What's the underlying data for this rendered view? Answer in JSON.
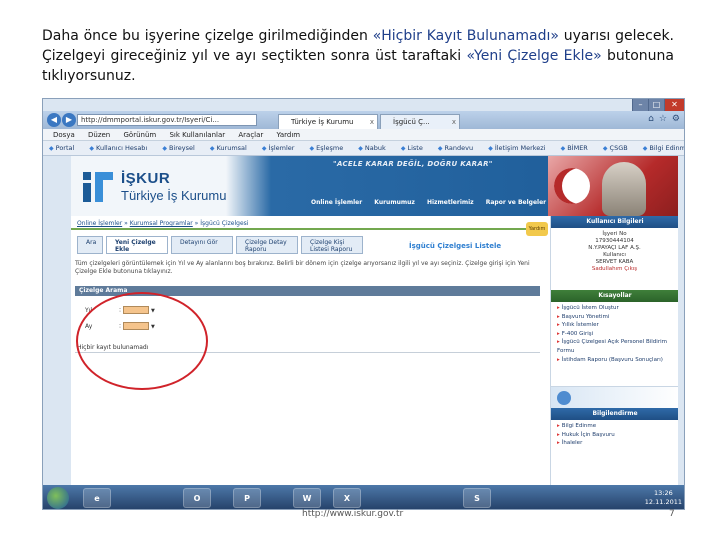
{
  "instruction": {
    "part1": "Daha önce bu işyerine çizelge girilmediğinden ",
    "highlight1": "«Hiçbir Kayıt Bulunamadı»",
    "part2": " uyarısı gelecek. Çizelgeyi gireceğiniz yıl ve ayı seçtikten sonra üst taraftaki ",
    "highlight2": "«Yeni Çizelge Ekle»",
    "part3": " butonuna tıklıyorsunuz."
  },
  "browser": {
    "address": "http://dmmportal.iskur.gov.tr/Isyeri/Ci...",
    "tabs": [
      "Türkiye İş Kurumu",
      "İşgücü Ç..."
    ],
    "menu": [
      "Dosya",
      "Düzen",
      "Görünüm",
      "Sık Kullanılanlar",
      "Araçlar",
      "Yardım"
    ],
    "favorites": [
      "Portal",
      "Kullanıcı Hesabı",
      "Bireysel",
      "Kurumsal",
      "İşlemler",
      "Eşleşme",
      "Nabuk",
      "Liste",
      "Randevu",
      "İletişim Merkezi",
      "BİMER",
      "ÇSGB",
      "Bilgi Edinme"
    ]
  },
  "site": {
    "logo_title": "İŞKUR",
    "logo_subtitle": "Türkiye İş Kurumu",
    "motto": "\"ACELE KARAR DEĞİL, DOĞRU KARAR\"",
    "nav": [
      "Online İşlemler",
      "Kurumumuz",
      "Hizmetlerimiz",
      "Rapor ve Belgeler"
    ],
    "breadcrumb": [
      "Online İşlemler",
      "Kurumsal Programlar",
      "İşgücü Çizelgesi"
    ],
    "help_badge": "Yardım"
  },
  "page": {
    "tabs": [
      "Yeni Çizelge Ekle",
      "Detayını Gör",
      "Çizelge Detay Raporu",
      "Çizelge Kişi Listesi Raporu"
    ],
    "search_tab": "Ara",
    "heading": "İşgücü Çizelgesi Listele",
    "info_text": "Tüm çizelgeleri görüntülemek için Yıl ve Ay alanlarını boş bırakınız. Belirli bir dönem için çizelge arıyorsanız ilgili yıl ve ayı seçiniz. Çizelge girişi için Yeni Çizelge Ekle butonuna tıklayınız.",
    "search_section": "Çizelge Arama",
    "year_label": "Yıl",
    "month_label": "Ay",
    "not_found": "Hiçbir kayıt bulunamadı"
  },
  "sidebar": {
    "user_head": "Kullanıcı Bilgileri",
    "user_lines": [
      "İşyeri No",
      "17930444104",
      "N.Y.PAYAÇI LAF A.Ş.",
      "Kullanıcı",
      "SERVET KABA",
      "Sadullahım Çıkış"
    ],
    "shortcuts_head": "Kısayollar",
    "shortcuts": [
      "İşgücü İstem Oluştur",
      "Başvuru Yönetimi",
      "Yıllık İstemler",
      "F-400 Girişi",
      "İşgücü Çizelgesi Açık Personel Bildirim Formu",
      "İstihdam Raporu (Başvuru Sonuçları)"
    ],
    "info_head": "Bilgilendirme",
    "info_items": [
      "Bilgi Edinme",
      "Hukuk İçin Başvuru",
      "İhaleler"
    ]
  },
  "taskbar": {
    "apps": [
      "e",
      "O",
      "P",
      "W",
      "X",
      "S"
    ],
    "time": "13:26",
    "date": "12.11.2011"
  },
  "footer": {
    "url": "http://www.iskur.gov.tr",
    "page": "7"
  }
}
